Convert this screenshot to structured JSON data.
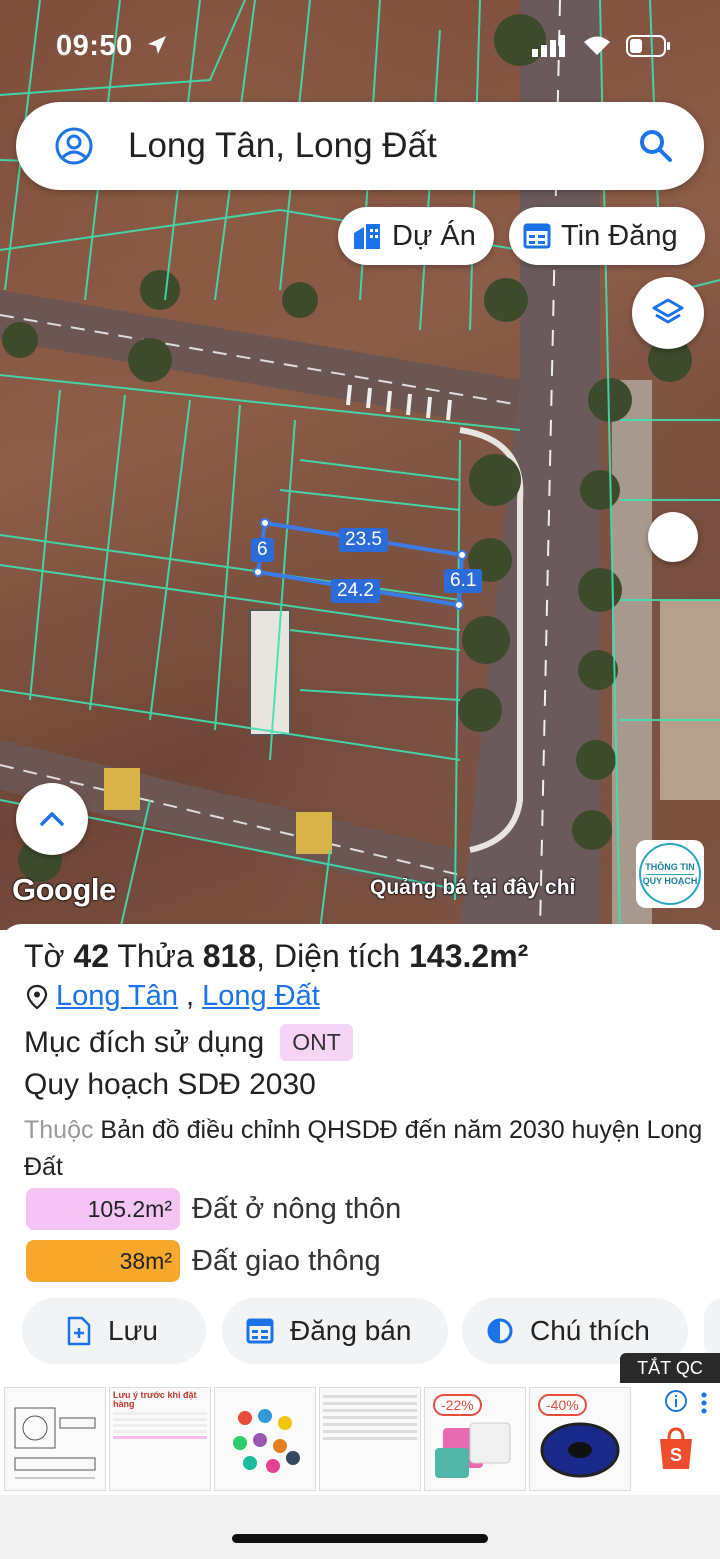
{
  "status_bar": {
    "time": "09:50"
  },
  "search": {
    "text": "Long Tân, Long Đất"
  },
  "chips": {
    "du_an": "Dự Án",
    "tin_dang": "Tin Đăng"
  },
  "map": {
    "dimensions": {
      "top": "23.5",
      "left": "6",
      "bottom": "24.2",
      "right": "6.1"
    },
    "google_logo": "Google",
    "ad_text": "Quảng bá tại đây chỉ",
    "info_badge": {
      "line1": "THÔNG TIN",
      "line2": "QUY HOẠCH"
    }
  },
  "parcel": {
    "to_label": "Tờ ",
    "to_value": "42",
    "thua_label": " Thửa ",
    "thua_value": "818",
    "area_label": ", Diện tích ",
    "area_value": "143.2m²",
    "location_1": "Long Tân",
    "location_sep": ",",
    "location_2": "Long Đất",
    "usage_label": "Mục đích sử dụng",
    "usage_code": "ONT",
    "plan_title": "Quy hoạch SDĐ 2030",
    "desc_prefix": "Thuộc",
    "desc_text": " Bản đồ điều chỉnh QHSDĐ đến năm 2030 huyện Long Đất",
    "areas": [
      {
        "value": "105.2m²",
        "label": "Đất ở nông thôn",
        "color": "#f4c4f4"
      },
      {
        "value": "38m²",
        "label": "Đất giao thông",
        "color": "#f6a72c"
      }
    ]
  },
  "actions": {
    "luu": "Lưu",
    "dang_ban": "Đăng bán",
    "chu_thich": "Chú thích"
  },
  "ads": {
    "close_label": "TẮT QC",
    "item2_title": "Lưu ý trước khi đặt hàng",
    "item3_label": "",
    "discount_1": "-22%",
    "discount_2": "-40%"
  },
  "colors": {
    "accent": "#1a73e8",
    "parcel_outline": "#3a7be8",
    "plot_lines": "#3fe0b0"
  }
}
